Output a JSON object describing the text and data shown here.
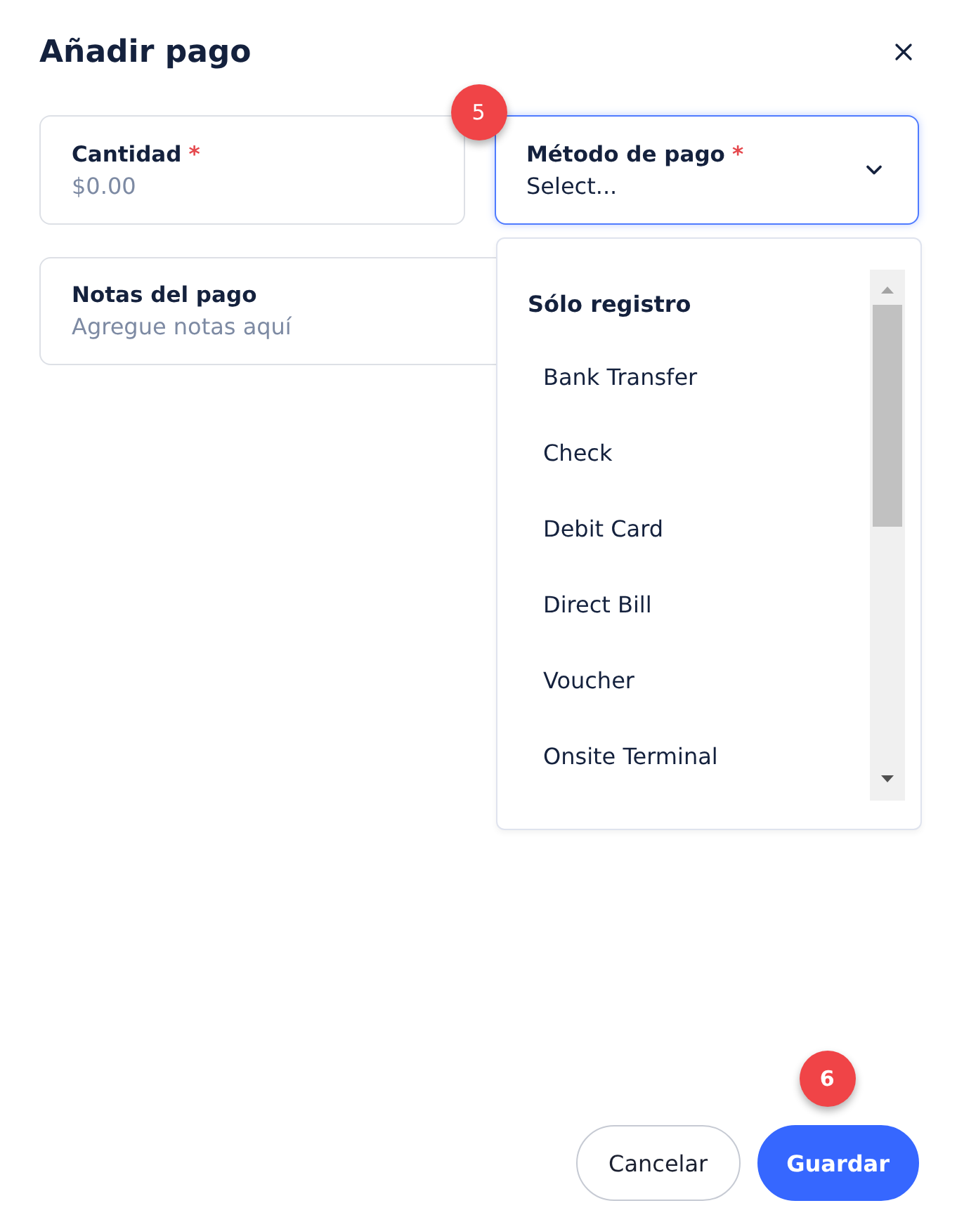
{
  "dialog": {
    "title": "Añadir pago"
  },
  "fields": [
    {
      "kind": "input",
      "label": "Cantidad",
      "required_mark": "*",
      "placeholder": "$0.00",
      "focused": false
    },
    {
      "kind": "select",
      "label": "Método de pago",
      "required_mark": "*",
      "placeholder": "Select...",
      "focused": true,
      "expanded": true,
      "badge": "5"
    }
  ],
  "notes": {
    "label": "Notas del pago",
    "placeholder": "Agregue notas aquí"
  },
  "dropdown": {
    "group": "Sólo registro",
    "options": [
      {
        "label": "Bank Transfer",
        "selected": false
      },
      {
        "label": "Check",
        "selected": false
      },
      {
        "label": "Debit Card",
        "selected": false
      },
      {
        "label": "Direct Bill",
        "selected": false
      },
      {
        "label": "Voucher",
        "selected": false
      },
      {
        "label": "Onsite Terminal",
        "selected": false
      }
    ]
  },
  "buttons": [
    {
      "label": "Cancelar",
      "kind": "secondary"
    },
    {
      "label": "Guardar",
      "kind": "primary",
      "badge": "6"
    }
  ]
}
